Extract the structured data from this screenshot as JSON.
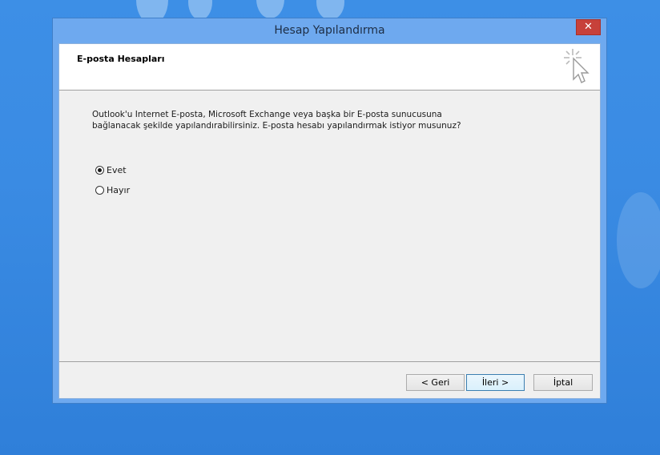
{
  "window": {
    "title": "Hesap Yapılandırma",
    "close_label": "✕"
  },
  "header": {
    "title": "E-posta Hesapları"
  },
  "prompt": {
    "line1": "Outlook'u Internet E-posta, Microsoft Exchange veya başka bir E-posta sunucusuna",
    "line2": "bağlanacak şekilde yapılandırabilirsiniz. E-posta hesabı yapılandırmak istiyor musunuz?"
  },
  "options": [
    {
      "label": "Evet",
      "selected": true
    },
    {
      "label": "Hayır",
      "selected": false
    }
  ],
  "buttons": {
    "back": "< Geri",
    "next": "İleri >",
    "cancel": "İptal"
  }
}
